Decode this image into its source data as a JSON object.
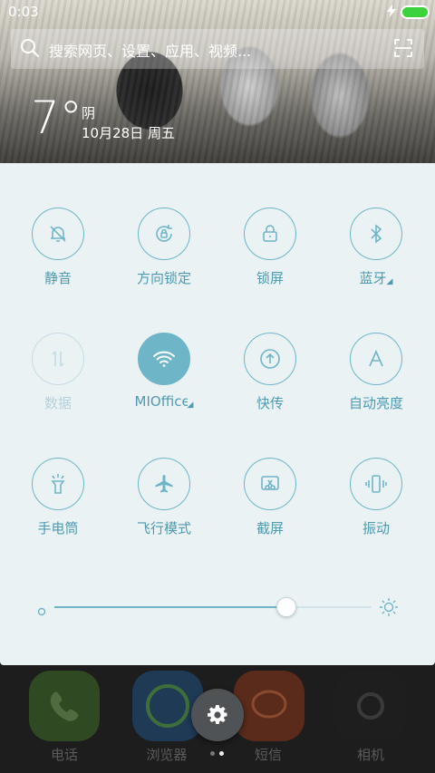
{
  "status_bar": {
    "time": "0:03",
    "battery_color": "#3cd23c"
  },
  "search": {
    "placeholder": "搜索网页、设置、应用、视频..."
  },
  "weather": {
    "temperature": "7°",
    "condition": "阴",
    "date": "10月28日 周五"
  },
  "quick_tiles": [
    {
      "label": "静音",
      "icon": "bell-off-icon",
      "state": "off"
    },
    {
      "label": "方向锁定",
      "icon": "rotation-lock-icon",
      "state": "off"
    },
    {
      "label": "锁屏",
      "icon": "lock-icon",
      "state": "off"
    },
    {
      "label": "蓝牙",
      "icon": "bluetooth-icon",
      "state": "off",
      "expandable": true
    },
    {
      "label": "数据",
      "icon": "data-arrows-icon",
      "state": "disabled"
    },
    {
      "label": "MIOffice",
      "icon": "wifi-icon",
      "state": "on",
      "expandable": true
    },
    {
      "label": "快传",
      "icon": "quick-share-icon",
      "state": "off"
    },
    {
      "label": "自动亮度",
      "icon": "auto-brightness-icon",
      "state": "off"
    },
    {
      "label": "手电筒",
      "icon": "flashlight-icon",
      "state": "off"
    },
    {
      "label": "飞行模式",
      "icon": "airplane-icon",
      "state": "off"
    },
    {
      "label": "截屏",
      "icon": "screenshot-icon",
      "state": "off"
    },
    {
      "label": "振动",
      "icon": "vibrate-icon",
      "state": "off"
    }
  ],
  "brightness": {
    "level": 0.73
  },
  "dock": [
    {
      "label": "电话",
      "icon": "phone-icon",
      "color": "#2f4a22"
    },
    {
      "label": "浏览器",
      "icon": "browser-icon",
      "color": "#1f3a55"
    },
    {
      "label": "短信",
      "icon": "message-icon",
      "color": "#5a2a1a"
    },
    {
      "label": "相机",
      "icon": "camera-icon",
      "color": "#1e1e1e"
    }
  ],
  "colors": {
    "accent": "#6fb5c8",
    "panel_bg": "#eaf2f4",
    "label": "#4f9ab1"
  }
}
